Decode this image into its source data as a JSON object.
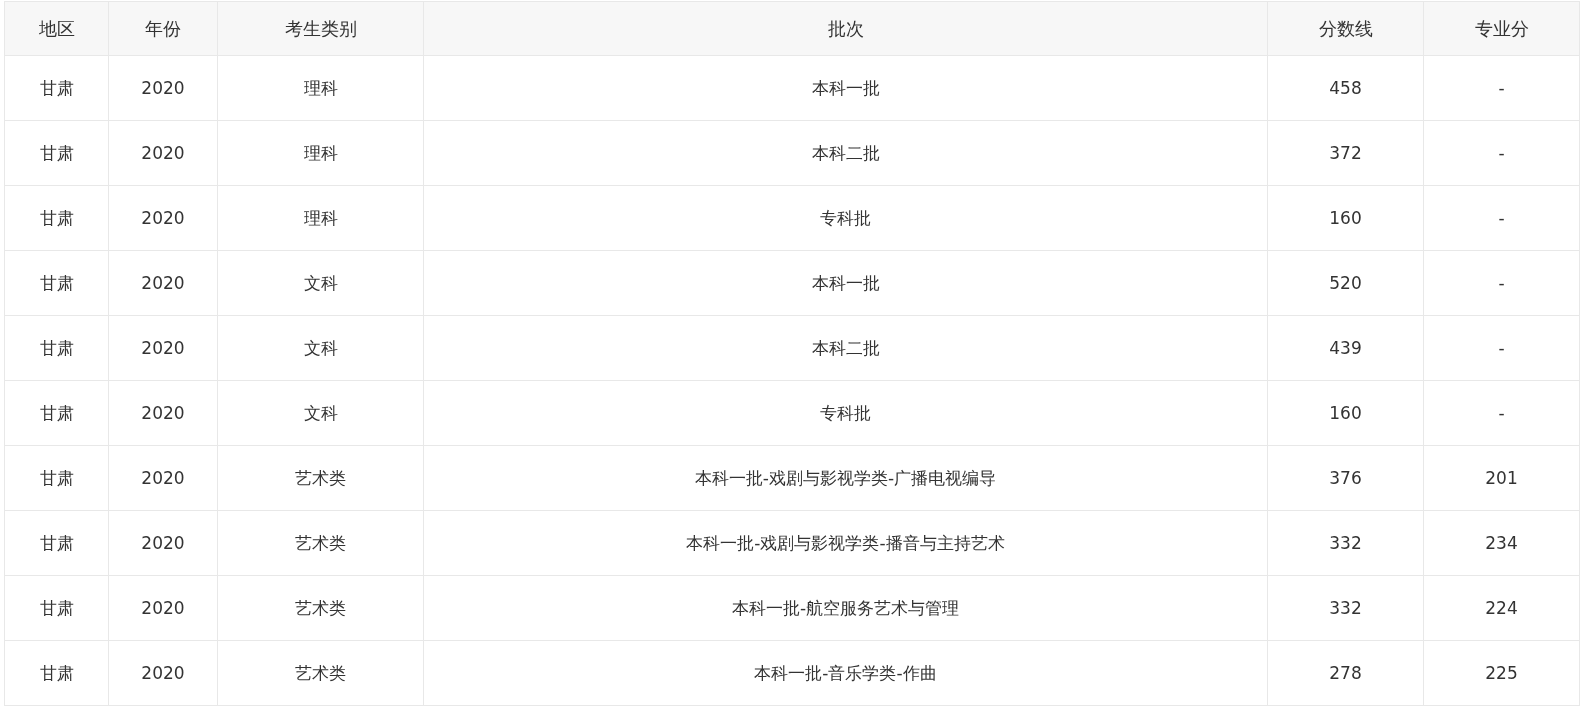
{
  "table": {
    "columns": [
      "地区",
      "年份",
      "考生类别",
      "批次",
      "分数线",
      "专业分"
    ],
    "rows": [
      [
        "甘肃",
        "2020",
        "理科",
        "本科一批",
        "458",
        "-"
      ],
      [
        "甘肃",
        "2020",
        "理科",
        "本科二批",
        "372",
        "-"
      ],
      [
        "甘肃",
        "2020",
        "理科",
        "专科批",
        "160",
        "-"
      ],
      [
        "甘肃",
        "2020",
        "文科",
        "本科一批",
        "520",
        "-"
      ],
      [
        "甘肃",
        "2020",
        "文科",
        "本科二批",
        "439",
        "-"
      ],
      [
        "甘肃",
        "2020",
        "文科",
        "专科批",
        "160",
        "-"
      ],
      [
        "甘肃",
        "2020",
        "艺术类",
        "本科一批-戏剧与影视学类-广播电视编导",
        "376",
        "201"
      ],
      [
        "甘肃",
        "2020",
        "艺术类",
        "本科一批-戏剧与影视学类-播音与主持艺术",
        "332",
        "234"
      ],
      [
        "甘肃",
        "2020",
        "艺术类",
        "本科一批-航空服务艺术与管理",
        "332",
        "224"
      ],
      [
        "甘肃",
        "2020",
        "艺术类",
        "本科一批-音乐学类-作曲",
        "278",
        "225"
      ]
    ]
  }
}
